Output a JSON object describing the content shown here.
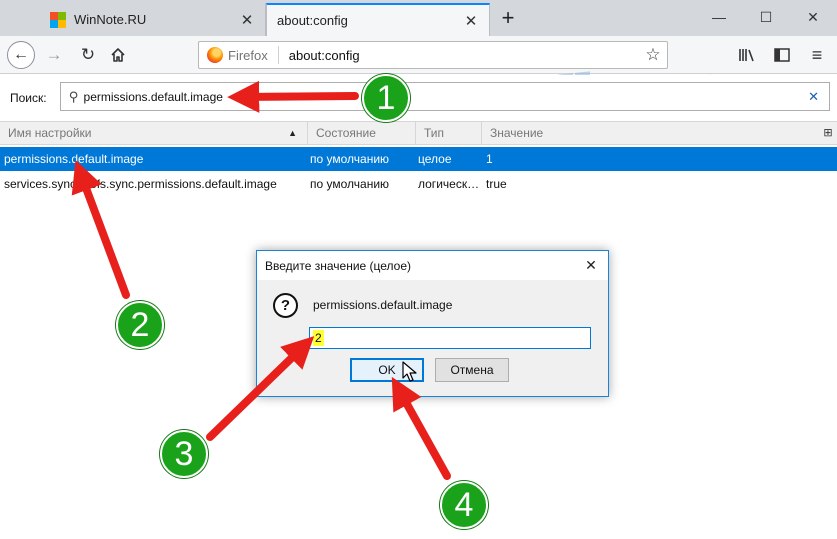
{
  "browser": {
    "tabs": [
      {
        "title": "WinNote.RU",
        "close": "✕"
      },
      {
        "title": "about:config",
        "close": "✕"
      }
    ],
    "new_tab": "+",
    "window_controls": {
      "minimize": "—",
      "maximize": "☐",
      "close": "✕"
    },
    "identity_label": "Firefox",
    "url": "about:config",
    "icons": {
      "back": "arrow-left-icon",
      "forward": "arrow-right-icon",
      "reload": "reload-icon",
      "home": "home-icon",
      "bookmark": "star-icon",
      "library": "library-icon",
      "sidebar": "sidebar-icon",
      "menu": "hamburger-icon"
    }
  },
  "search": {
    "label": "Поиск:",
    "value": "permissions.default.image",
    "clear": "✕"
  },
  "table": {
    "columns": [
      "Имя настройки",
      "Состояние",
      "Тип",
      "Значение"
    ],
    "rows": [
      {
        "name": "permissions.default.image",
        "status": "по умолчанию",
        "type": "целое",
        "value": "1",
        "selected": true
      },
      {
        "name": "services.sync.prefs.sync.permissions.default.image",
        "status": "по умолчанию",
        "type": "логическ…",
        "value": "true",
        "selected": false
      }
    ]
  },
  "dialog": {
    "title": "Введите значение (целое)",
    "close": "✕",
    "message": "permissions.default.image",
    "input_value": "2",
    "ok_label": "OK",
    "cancel_label": "Отмена",
    "question_mark": "?"
  },
  "watermark": {
    "text": "WINNOTE.RU"
  },
  "annotations": {
    "markers": [
      "1",
      "2",
      "3",
      "4"
    ],
    "arrow_color": "#e8201c",
    "marker_color": "#1aa31a"
  },
  "colors": {
    "selection": "#0078d7",
    "accent": "#0a84ff",
    "highlight": "#ffff33"
  }
}
